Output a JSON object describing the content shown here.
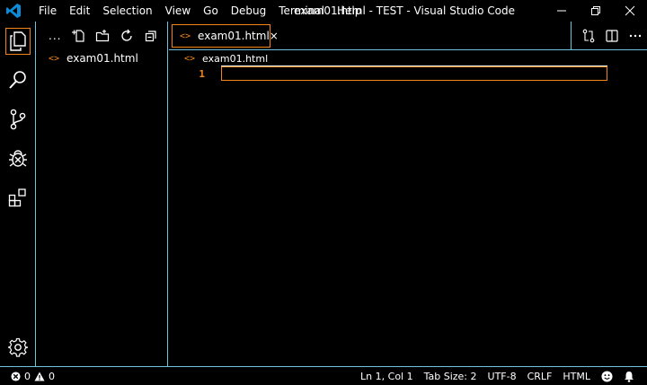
{
  "menu": [
    "File",
    "Edit",
    "Selection",
    "View",
    "Go",
    "Debug",
    "Terminal",
    "Help"
  ],
  "window_title": "exam01.html - TEST - Visual Studio Code",
  "sidebar": {
    "more_label": "...",
    "files": [
      {
        "name": "exam01.html",
        "icon": "html-file-icon"
      }
    ]
  },
  "editor": {
    "tab": {
      "label": "exam01.html",
      "close": "×"
    },
    "breadcrumb": "exam01.html",
    "line_numbers": [
      "1"
    ]
  },
  "status": {
    "errors": "0",
    "warnings": "0",
    "position": "Ln 1, Col 1",
    "tab_size": "Tab Size: 2",
    "encoding": "UTF-8",
    "eol": "CRLF",
    "language": "HTML"
  },
  "colors": {
    "accent": "#f38518",
    "border": "#6fc3df",
    "logo": "#0a8cd8",
    "background": "#000000"
  }
}
